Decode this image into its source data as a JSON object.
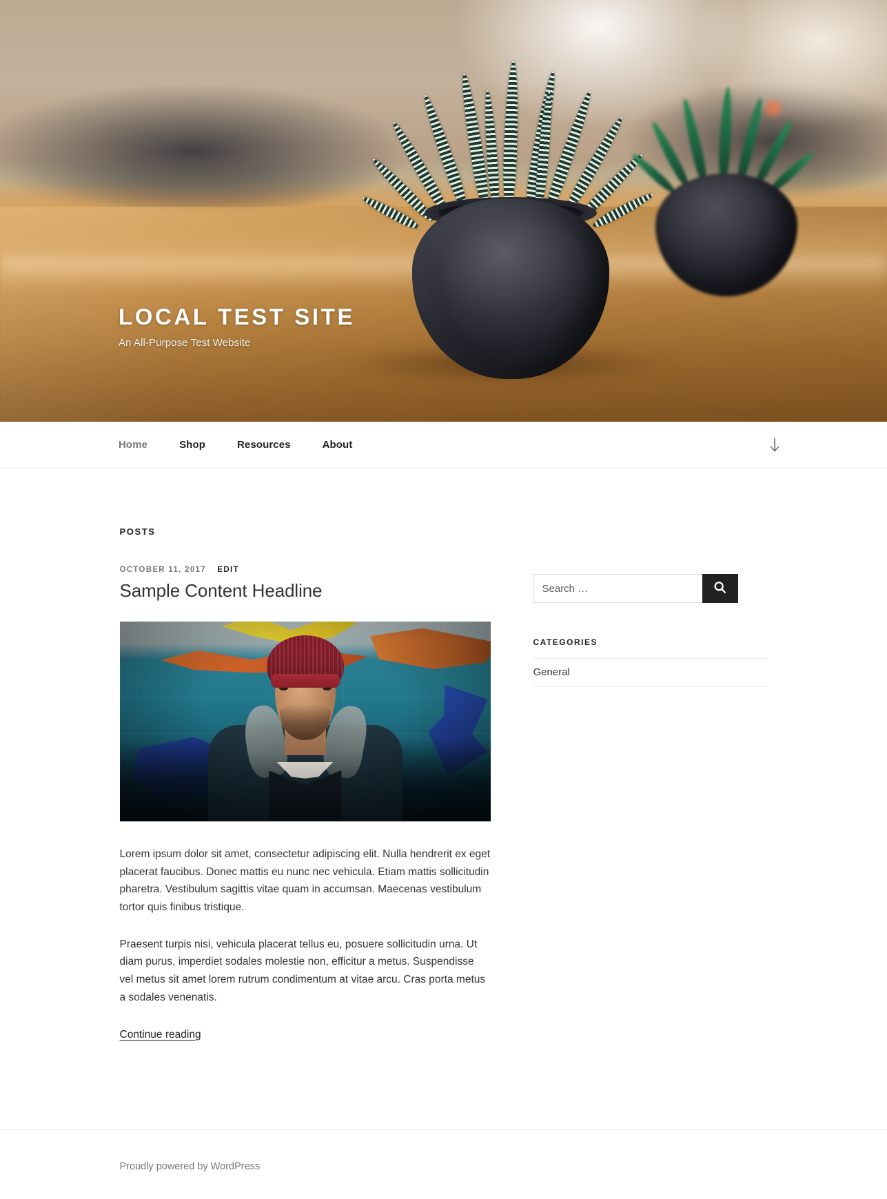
{
  "header": {
    "site_title": "Local Test Site",
    "site_description": "An All-Purpose Test Website"
  },
  "nav": {
    "items": [
      {
        "label": "Home",
        "current": true
      },
      {
        "label": "Shop",
        "current": false
      },
      {
        "label": "Resources",
        "current": false
      },
      {
        "label": "About",
        "current": false
      }
    ],
    "scroll_down_icon": "arrow-down-icon"
  },
  "main": {
    "posts_label": "Posts",
    "post": {
      "date": "October 11, 2017",
      "edit_label": "Edit",
      "title": "Sample Content Headline",
      "featured_image_alt": "Man in red beanie standing in front of a teal graffiti wall",
      "paragraphs": [
        "Lorem ipsum dolor sit amet, consectetur adipiscing elit. Nulla hendrerit ex eget placerat faucibus. Donec mattis eu nunc nec vehicula. Etiam mattis sollicitudin pharetra. Vestibulum sagittis vitae quam in accumsan. Maecenas vestibulum tortor quis finibus tristique.",
        "Praesent turpis nisi, vehicula placerat tellus eu, posuere sollicitudin urna. Ut diam purus, imperdiet sodales molestie non, efficitur a metus. Suspendisse vel metus sit amet lorem rutrum condimentum at vitae arcu. Cras porta metus a sodales venenatis."
      ],
      "more_label": "Continue reading"
    }
  },
  "sidebar": {
    "search": {
      "placeholder": "Search …",
      "value": "",
      "submit_icon": "search-icon"
    },
    "categories": {
      "title": "Categories",
      "items": [
        {
          "label": "General"
        }
      ]
    }
  },
  "footer": {
    "credit": "Proudly powered by WordPress"
  },
  "colors": {
    "accent_dark": "#222222",
    "text": "#333333",
    "muted": "#767676",
    "border": "#eceded",
    "beanie_red": "#9b2232",
    "wall_teal": "#23798c"
  }
}
